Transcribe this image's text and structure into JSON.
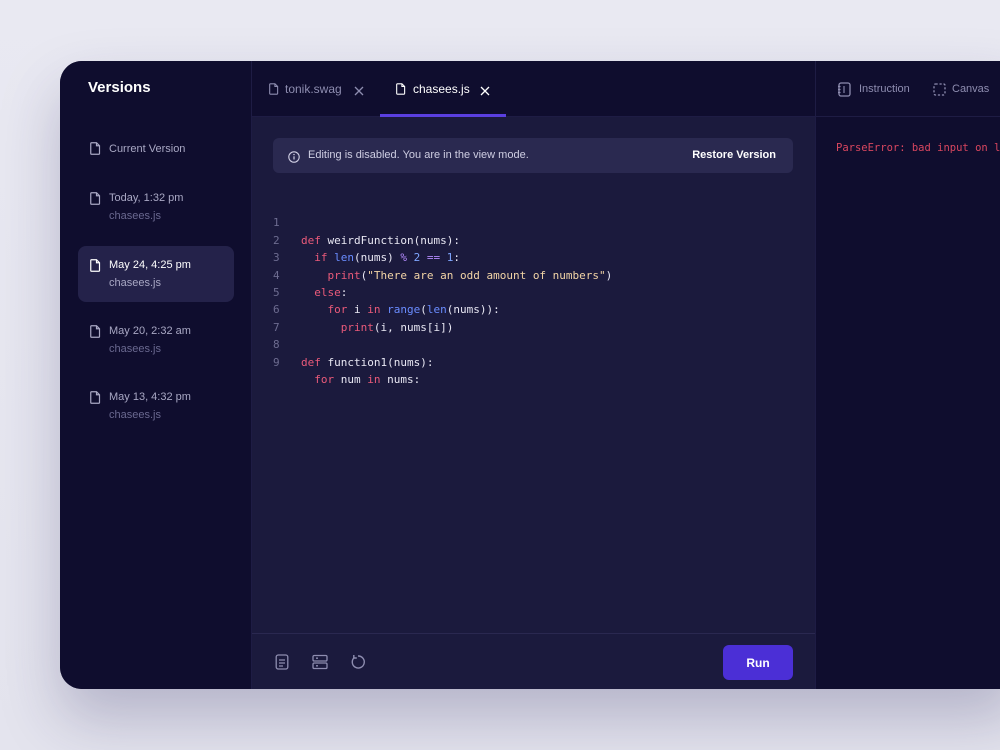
{
  "sidebar": {
    "title": "Versions",
    "items": [
      {
        "label": "Current Version",
        "file": ""
      },
      {
        "label": "Today, 1:32 pm",
        "file": "chasees.js"
      },
      {
        "label": "May 24, 4:25 pm",
        "file": "chasees.js",
        "active": true
      },
      {
        "label": "May 20, 2:32 am",
        "file": "chasees.js"
      },
      {
        "label": "May 13, 4:32 pm",
        "file": "chasees.js"
      }
    ]
  },
  "tabs": [
    {
      "label": "tonik.swag",
      "active": false
    },
    {
      "label": "chasees.js",
      "active": true
    }
  ],
  "notice": {
    "text": "Editing is disabled. You are in the view mode.",
    "action": "Restore Version"
  },
  "code": {
    "line_numbers": [
      "1",
      "2",
      "3",
      "4",
      "5",
      "6",
      "7",
      "8",
      "9"
    ],
    "lines": [
      "def weirdFunction(nums):",
      "  if len(nums) % 2 == 1:",
      "    print(\"There are an odd amount of numbers\")",
      "  else:",
      "    for i in range(len(nums)):",
      "      print(i, nums[i])",
      "",
      "def function1(nums):",
      "  for num in nums:"
    ]
  },
  "bottombar": {
    "icons": [
      "document-icon",
      "server-icon",
      "refresh-icon"
    ],
    "run_label": "Run"
  },
  "rightpanel": {
    "tabs": [
      {
        "label": "Instruction",
        "icon": "notebook-icon"
      },
      {
        "label": "Canvas",
        "icon": "canvas-icon"
      }
    ],
    "error": "ParseError: bad input on l"
  },
  "colors": {
    "background": "#0f0d2e",
    "editor": "#1b1a3d",
    "accent": "#4b2fd6",
    "keyword": "#ea5a7a",
    "builtin": "#6a8cff",
    "string": "#f2d4a6",
    "error": "#d9465f"
  }
}
